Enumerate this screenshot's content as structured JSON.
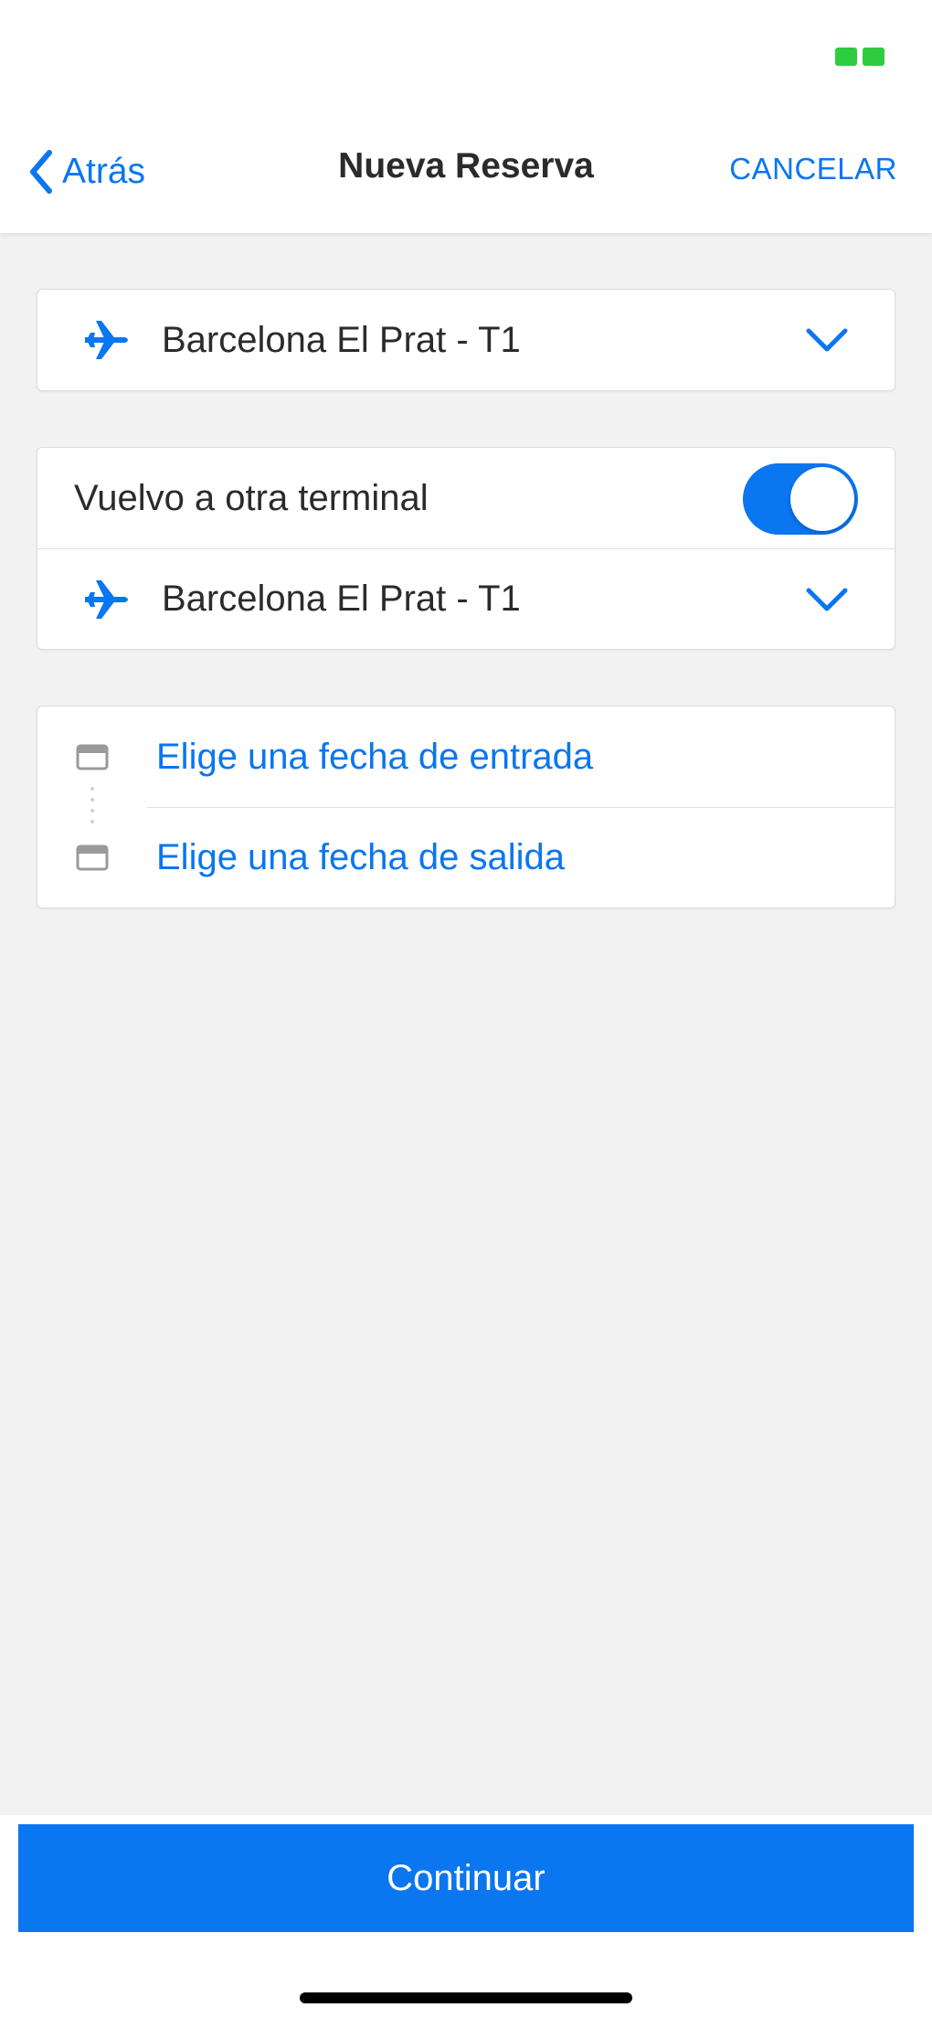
{
  "nav": {
    "back_label": "Atrás",
    "title": "Nueva Reserva",
    "cancel_label": "CANCELAR"
  },
  "departure": {
    "terminal": "Barcelona El Prat - T1",
    "icon": "airplane-icon"
  },
  "return_terminal": {
    "toggle_label": "Vuelvo a otra terminal",
    "toggle_on": true,
    "terminal": "Barcelona El Prat - T1",
    "icon": "airplane-icon"
  },
  "dates": {
    "entry_label": "Elige una fecha de entrada",
    "exit_label": "Elige una fecha de salida",
    "icon": "calendar-icon"
  },
  "footer": {
    "continue_label": "Continuar"
  },
  "colors": {
    "accent": "#0a76f0",
    "background": "#f2f2f2",
    "status_indicator": "#2ecc40"
  }
}
